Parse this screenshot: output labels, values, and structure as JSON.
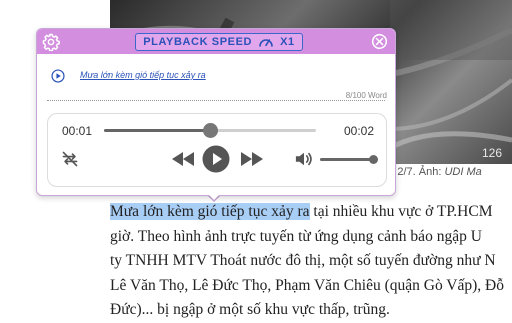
{
  "popup": {
    "speed_label": "PLAYBACK SPEED",
    "speed_value": "X1",
    "sentence": "Mưa lớn kèm gió tiếp tục xảy ra",
    "word_count": "8/100 Word"
  },
  "player": {
    "current_time": "00:01",
    "duration": "00:02",
    "progress": 0.5,
    "volume": 1.0
  },
  "article": {
    "photo_number": "126",
    "caption_prefix": "chiều 2/7. Ảnh: ",
    "caption_author": "UDI Ma",
    "lines": [
      {
        "hl": "Mưa lớn kèm gió tiếp tục xảy ra",
        "rest": " tại nhiều khu vực ở TP.HCM"
      },
      {
        "hl": "",
        "rest": "giờ. Theo hình ảnh trực tuyến từ ứng dụng cảnh báo ngập U"
      },
      {
        "hl": "",
        "rest": "ty TNHH MTV Thoát nước đô thị, một số tuyến đường như N"
      },
      {
        "hl": "",
        "rest": "Lê Văn Thọ, Lê Đức Thọ, Phạm Văn Chiêu (quận Gò Vấp), Đỗ"
      },
      {
        "hl": "",
        "rest": "Đức)... bị ngập ở một số khu vực thấp, trũng."
      }
    ]
  },
  "colors": {
    "header": "#d38ee0",
    "accent": "#2b52b8",
    "highlight": "#a9cef5"
  },
  "icons": {
    "settings": "gear-icon",
    "close": "close-icon",
    "speed": "speedometer-icon",
    "play_sentence": "play-circle-icon",
    "repeat": "repeat-off-icon",
    "rewind": "rewind-icon",
    "play": "play-icon",
    "forward": "fast-forward-icon",
    "volume": "volume-icon"
  }
}
